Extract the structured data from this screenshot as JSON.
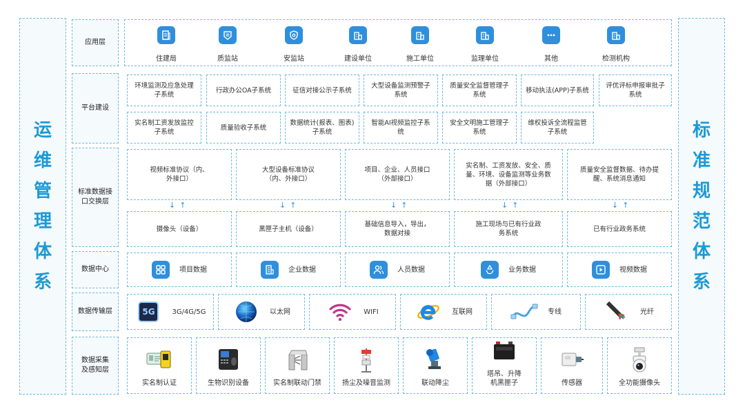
{
  "left_title": [
    "运",
    "维",
    "管",
    "理",
    "体",
    "系"
  ],
  "right_title": [
    "标",
    "准",
    "规",
    "范",
    "体",
    "系"
  ],
  "layers": {
    "app": "应用层",
    "platform": "平台建设",
    "interface": "标准数据接口交换层",
    "datacenter": "数据中心",
    "transport": "数据传输层",
    "acquisition": "数据采集及感知层"
  },
  "apps": [
    {
      "label": "住建局",
      "icon": "document-icon"
    },
    {
      "label": "质监站",
      "icon": "badge-icon"
    },
    {
      "label": "安监站",
      "icon": "shield-icon"
    },
    {
      "label": "建设单位",
      "icon": "building-icon"
    },
    {
      "label": "施工单位",
      "icon": "building-icon"
    },
    {
      "label": "监理单位",
      "icon": "building-icon"
    },
    {
      "label": "其他",
      "icon": "more-icon"
    },
    {
      "label": "检测机构",
      "icon": "building-icon"
    }
  ],
  "platform_row1": [
    "环境监测及应急处理子系统",
    "行政办公OA子系统",
    "征信对接公示子系统",
    "大型设备监测预警子系统",
    "质量安全监督管理子系统",
    "移动执法(APP)子系统",
    "评优评标申报审批子系统"
  ],
  "platform_row2": [
    "实名制工资发放监控子系统",
    "质量验收子系统",
    "数据统计(报表、图表)子系统",
    "智能AI视频监控子系统",
    "安全文明施工管理子系统",
    "维权投诉全流程监管子系统"
  ],
  "interface_top": [
    "视频标准协议（内、外接口）",
    "大型设备标准协议（内、外接口）",
    "项目、企业、人员接口（外部接口）",
    "实名制、工资发放、安全、质量、环境、设备监测等业务数据（外部接口）",
    "质量安全监督数据、待办提醒、系统消息通知"
  ],
  "interface_bottom": [
    "摄像头（设备）",
    "黑匣子主机（设备）",
    "基础信息导入，导出，数据对接",
    "施工现场与已有行业政务系统",
    "已有行业政务系统"
  ],
  "arrows": "↓↑",
  "datacenter": [
    {
      "label": "项目数据",
      "icon": "grid-icon"
    },
    {
      "label": "企业数据",
      "icon": "company-icon"
    },
    {
      "label": "人员数据",
      "icon": "people-icon"
    },
    {
      "label": "业务数据",
      "icon": "recycle-icon"
    },
    {
      "label": "视频数据",
      "icon": "play-icon"
    }
  ],
  "transport": [
    {
      "label": "3G/4G/5G",
      "icon": "5g-icon",
      "badge": "5G"
    },
    {
      "label": "以太网",
      "icon": "globe-icon"
    },
    {
      "label": "WIFI",
      "icon": "wifi-icon"
    },
    {
      "label": "互联网",
      "icon": "ie-icon"
    },
    {
      "label": "专线",
      "icon": "cable-icon"
    },
    {
      "label": "光纤",
      "icon": "fiber-icon"
    }
  ],
  "acquisition": [
    {
      "label": "实名制认证",
      "icon": "id-card-icon"
    },
    {
      "label": "生物识别设备",
      "icon": "fingerprint-device-icon"
    },
    {
      "label": "实名制联动门禁",
      "icon": "turnstile-icon"
    },
    {
      "label": "扬尘及噪音监测",
      "icon": "dust-monitor-icon"
    },
    {
      "label": "联动降尘",
      "icon": "fog-cannon-icon"
    },
    {
      "label": "塔吊、升降机黑匣子",
      "icon": "battery-box-icon"
    },
    {
      "label": "传感器",
      "icon": "sensor-icon"
    },
    {
      "label": "全功能摄像头",
      "icon": "dome-camera-icon"
    }
  ],
  "colors": {
    "accent": "#1c9ad6",
    "icon_bg": "#2f8fdc",
    "border": "#6db8e0"
  }
}
